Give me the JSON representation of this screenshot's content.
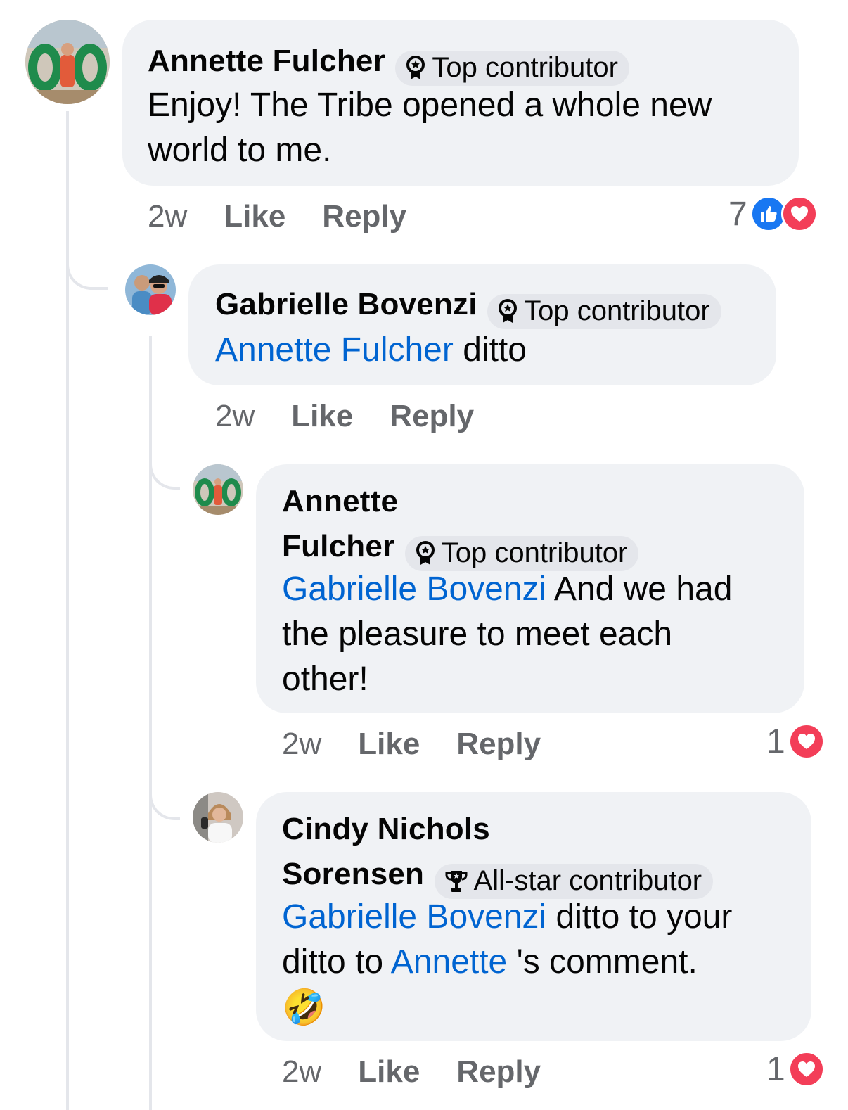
{
  "comments": [
    {
      "author": "Annette Fulcher",
      "badge": "Top contributor",
      "body": "Enjoy! The Tribe opened a whole new world to me.",
      "time": "2w",
      "like_label": "Like",
      "reply_label": "Reply",
      "reaction_count": "7",
      "reactions": [
        "like-icon",
        "love-icon"
      ]
    },
    {
      "author": "Gabrielle Bovenzi",
      "badge": "Top contributor",
      "mention": "Annette Fulcher",
      "body": "ditto",
      "time": "2w",
      "like_label": "Like",
      "reply_label": "Reply"
    },
    {
      "author_line1": "Annette",
      "author_line2": "Fulcher",
      "badge": "Top contributor",
      "mention": "Gabrielle Bovenzi",
      "body_line1": " And we had",
      "body_line2": "the pleasure to meet each",
      "body_line3": "other!",
      "time": "2w",
      "like_label": "Like",
      "reply_label": "Reply",
      "reaction_count": "1",
      "reactions": [
        "love-icon"
      ]
    },
    {
      "author_line1": "Cindy Nichols",
      "author_line2": "Sorensen",
      "badge": "All-star contributor",
      "mention": "Gabrielle Bovenzi",
      "body_part1": " ditto to your",
      "body_part2": "ditto to ",
      "mention2": "Annette",
      "body_part3": " 's comment.",
      "emoji": "🤣",
      "time": "2w",
      "like_label": "Like",
      "reply_label": "Reply",
      "reaction_count": "1",
      "reactions": [
        "love-icon"
      ]
    }
  ],
  "colors": {
    "bubble": "#f0f2f5",
    "mention": "#0064d1",
    "meta": "#65676b",
    "like": "#1877f2",
    "love": "#f33e58"
  }
}
